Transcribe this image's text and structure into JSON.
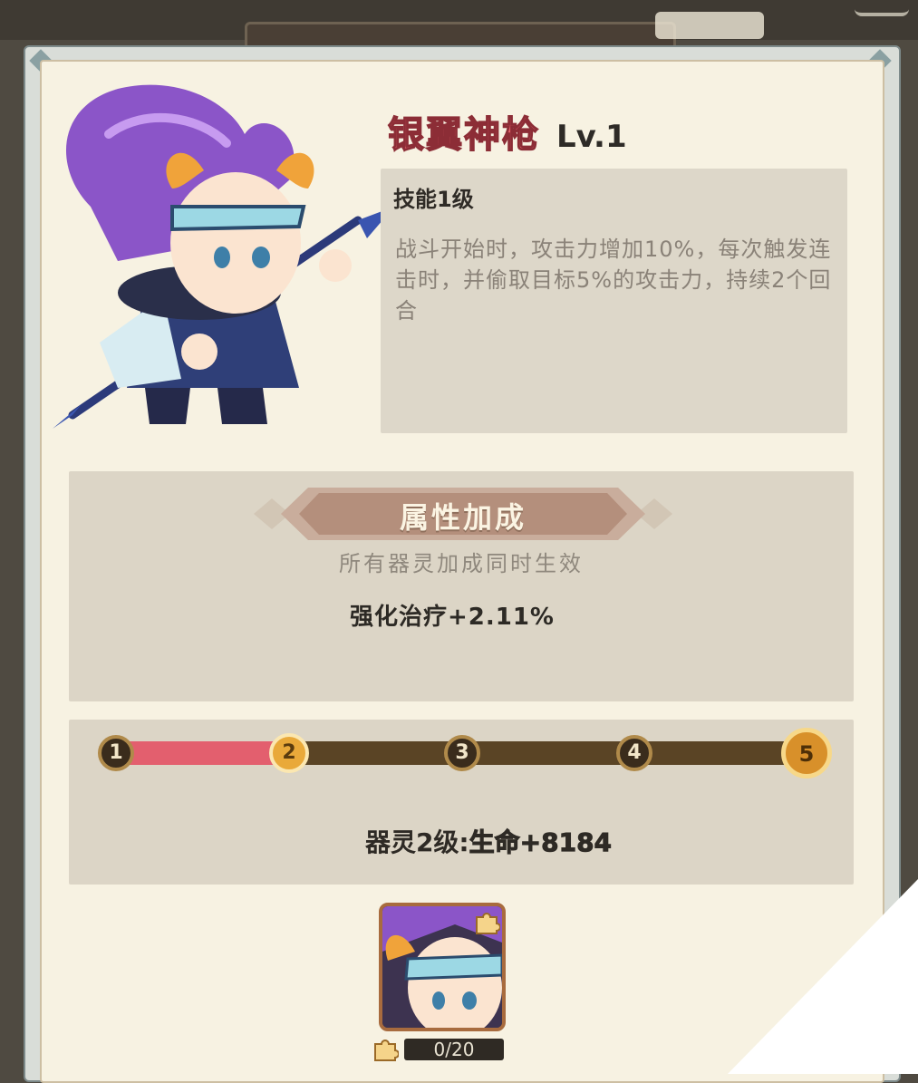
{
  "hero": {
    "name": "银翼神枪",
    "level": "Lv.1",
    "portrait": "hero-portrait"
  },
  "skill": {
    "title": "技能1级",
    "description": "战斗开始时，攻击力增加10%，每次触发连击时，并偷取目标5%的攻击力，持续2个回合"
  },
  "attribute": {
    "header": "属性加成",
    "subtitle": "所有器灵加成同时生效",
    "bonus": "强化治疗+2.11%"
  },
  "progress": {
    "nodes": [
      "1",
      "2",
      "3",
      "4",
      "5"
    ],
    "current": 2,
    "fill_fraction": 0.25,
    "label": "器灵2级:",
    "value": "生命+8184"
  },
  "shard": {
    "icon": "puzzle-icon",
    "count": "0/20"
  },
  "colors": {
    "name_red": "#e4606a",
    "fill_red": "#e35f6e",
    "gold": "#e9a93a",
    "panel": "#f7f2e2",
    "box": "#dcd5c6"
  }
}
